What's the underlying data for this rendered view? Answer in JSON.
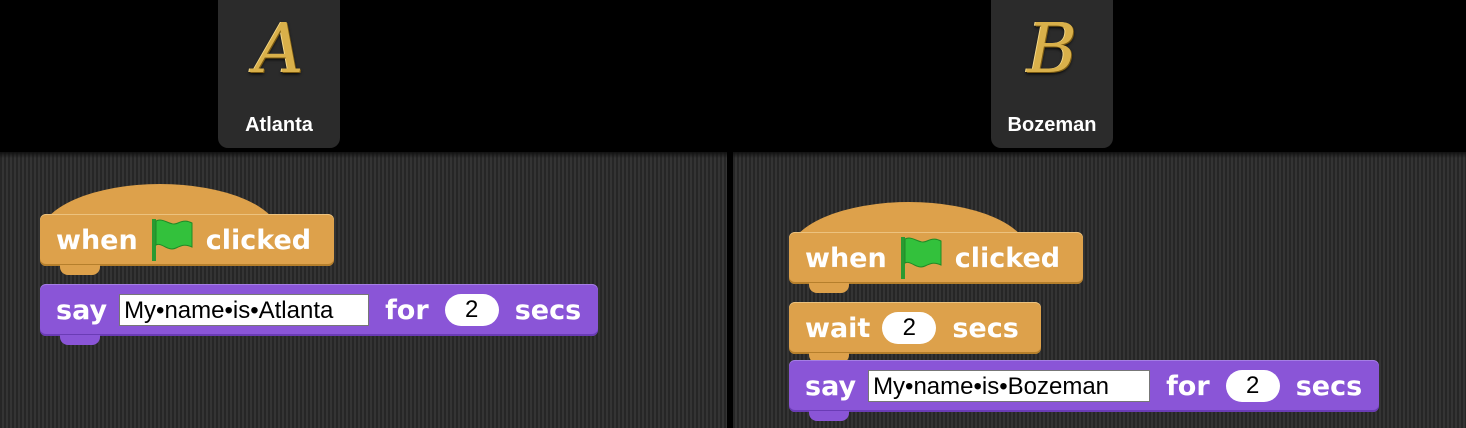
{
  "sprites": [
    {
      "glyph": "A",
      "name": "Atlanta"
    },
    {
      "glyph": "B",
      "name": "Bozeman"
    }
  ],
  "scripts": {
    "atlanta": {
      "hat": {
        "word1": "when",
        "icon": "green-flag-icon",
        "word2": "clicked"
      },
      "say": {
        "label": "say",
        "text": "My•name•is•Atlanta",
        "for_label": "for",
        "secs_value": "2",
        "secs_label": "secs"
      }
    },
    "bozeman": {
      "hat": {
        "word1": "when",
        "icon": "green-flag-icon",
        "word2": "clicked"
      },
      "wait": {
        "label": "wait",
        "value": "2",
        "secs_label": "secs"
      },
      "say": {
        "label": "say",
        "text": "My•name•is•Bozeman",
        "for_label": "for",
        "secs_value": "2",
        "secs_label": "secs"
      }
    }
  },
  "colors": {
    "events": "#dda14b",
    "looks": "#8a55d7",
    "flag": "#33c13c",
    "sprite_glyph": "#d9b04a"
  }
}
